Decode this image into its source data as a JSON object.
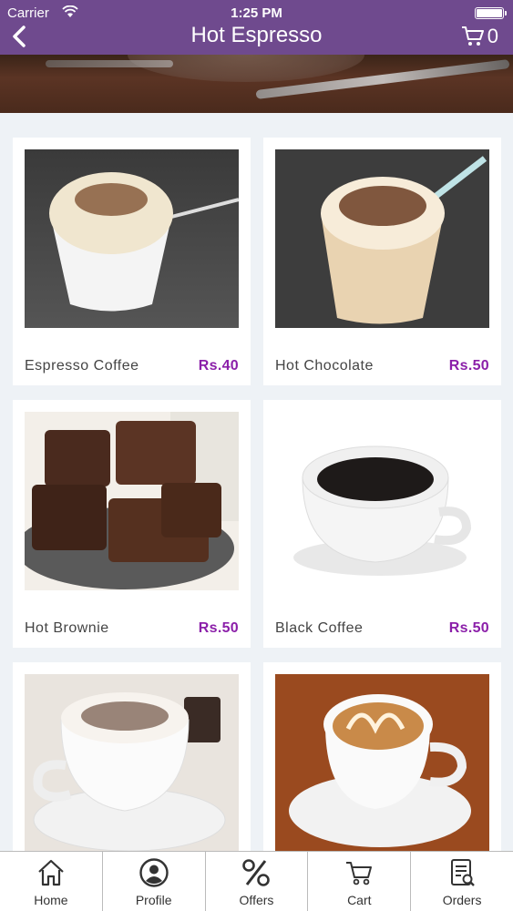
{
  "status_bar": {
    "carrier": "Carrier",
    "time": "1:25 PM"
  },
  "header": {
    "title": "Hot Espresso",
    "cart_count": "0"
  },
  "colors": {
    "header_bg": "#6f4a8e",
    "price": "#8b1fa9",
    "page_bg": "#eef2f6"
  },
  "products": [
    {
      "name": "Espresso Coffee",
      "price": "Rs.40"
    },
    {
      "name": "Hot Chocolate",
      "price": "Rs.50"
    },
    {
      "name": "Hot Brownie",
      "price": "Rs.50"
    },
    {
      "name": "Black Coffee",
      "price": "Rs.50"
    },
    {
      "name": "",
      "price": ""
    },
    {
      "name": "",
      "price": ""
    }
  ],
  "tabs": [
    {
      "label": "Home",
      "icon": "home-icon"
    },
    {
      "label": "Profile",
      "icon": "profile-icon"
    },
    {
      "label": "Offers",
      "icon": "percent-icon"
    },
    {
      "label": "Cart",
      "icon": "cart-icon"
    },
    {
      "label": "Orders",
      "icon": "orders-icon"
    }
  ]
}
